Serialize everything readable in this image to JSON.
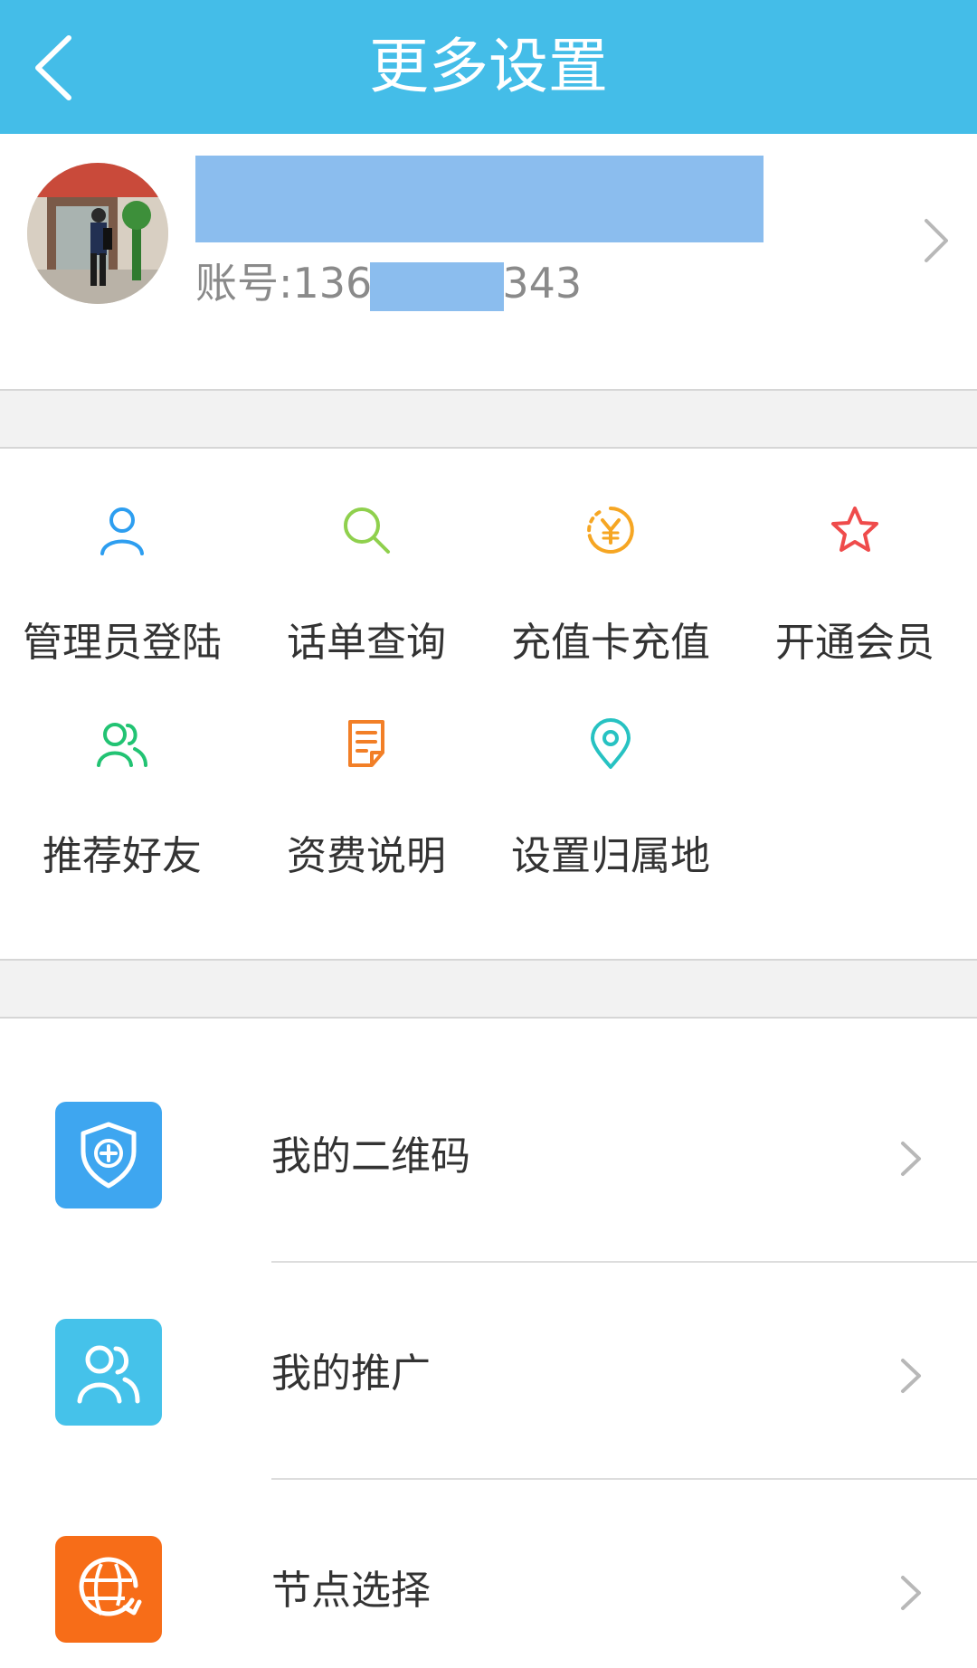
{
  "header": {
    "title": "更多设置",
    "bg_color": "#44bde8"
  },
  "profile": {
    "account_prefix": "账号:136",
    "account_suffix": "343",
    "redaction_color": "#8bbdee"
  },
  "grid": {
    "items": [
      {
        "label": "管理员登陆",
        "icon": "person-icon",
        "color": "#2d9ef0"
      },
      {
        "label": "话单查询",
        "icon": "search-icon",
        "color": "#8fd04d"
      },
      {
        "label": "充值卡充值",
        "icon": "yen-coin-icon",
        "color": "#f6a623"
      },
      {
        "label": "开通会员",
        "icon": "star-icon",
        "color": "#ef4b4b"
      },
      {
        "label": "推荐好友",
        "icon": "friends-icon",
        "color": "#22c373"
      },
      {
        "label": "资费说明",
        "icon": "document-icon",
        "color": "#f27f27"
      },
      {
        "label": "设置归属地",
        "icon": "location-pin-icon",
        "color": "#27c2c2"
      }
    ]
  },
  "list": {
    "items": [
      {
        "label": "我的二维码",
        "icon": "shield-plus-icon",
        "color": "#3ea6f0"
      },
      {
        "label": "我的推广",
        "icon": "people-icon",
        "color": "#45c2ea"
      },
      {
        "label": "节点选择",
        "icon": "globe-icon",
        "color": "#f76d18"
      }
    ]
  }
}
